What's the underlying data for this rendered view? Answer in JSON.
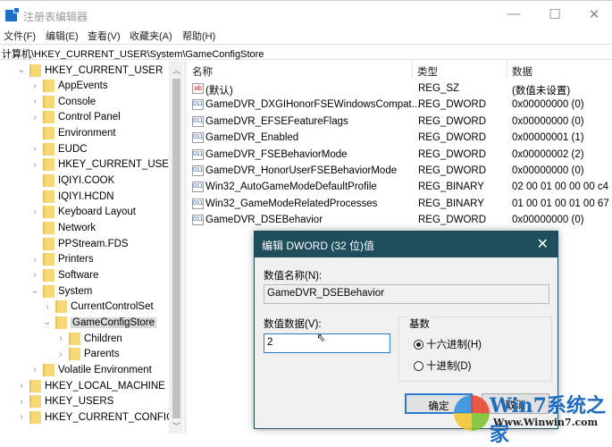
{
  "window": {
    "title": "注册表编辑器",
    "minimize": "—",
    "maximize": "☐",
    "close": "✕"
  },
  "menu": [
    "文件(F)",
    "编辑(E)",
    "查看(V)",
    "收藏夹(A)",
    "帮助(H)"
  ],
  "address": "计算机\\HKEY_CURRENT_USER\\System\\GameConfigStore",
  "tree": [
    {
      "label": "HKEY_CURRENT_USER",
      "level": 0,
      "exp": "⌄"
    },
    {
      "label": "AppEvents",
      "level": 1,
      "exp": "›"
    },
    {
      "label": "Console",
      "level": 1,
      "exp": "›"
    },
    {
      "label": "Control Panel",
      "level": 1,
      "exp": "›"
    },
    {
      "label": "Environment",
      "level": 1,
      "exp": ""
    },
    {
      "label": "EUDC",
      "level": 1,
      "exp": "›"
    },
    {
      "label": "HKEY_CURRENT_USER",
      "level": 1,
      "exp": "›"
    },
    {
      "label": "IQIYI.COOK",
      "level": 1,
      "exp": ""
    },
    {
      "label": "IQIYI.HCDN",
      "level": 1,
      "exp": ""
    },
    {
      "label": "Keyboard Layout",
      "level": 1,
      "exp": "›"
    },
    {
      "label": "Network",
      "level": 1,
      "exp": ""
    },
    {
      "label": "PPStream.FDS",
      "level": 1,
      "exp": ""
    },
    {
      "label": "Printers",
      "level": 1,
      "exp": "›"
    },
    {
      "label": "Software",
      "level": 1,
      "exp": "›"
    },
    {
      "label": "System",
      "level": 1,
      "exp": "⌄"
    },
    {
      "label": "CurrentControlSet",
      "level": 2,
      "exp": "›"
    },
    {
      "label": "GameConfigStore",
      "level": 2,
      "exp": "⌄",
      "selected": true
    },
    {
      "label": "Children",
      "level": 3,
      "exp": "›"
    },
    {
      "label": "Parents",
      "level": 3,
      "exp": "›"
    },
    {
      "label": "Volatile Environment",
      "level": 1,
      "exp": "›"
    },
    {
      "label": "HKEY_LOCAL_MACHINE",
      "level": 0,
      "exp": "›"
    },
    {
      "label": "HKEY_USERS",
      "level": 0,
      "exp": "›"
    },
    {
      "label": "HKEY_CURRENT_CONFIG",
      "level": 0,
      "exp": "›"
    }
  ],
  "columns": {
    "name": "名称",
    "type": "类型",
    "data": "数据"
  },
  "values": [
    {
      "icon": "ab",
      "name": "(默认)",
      "type": "REG_SZ",
      "data": "(数值未设置)"
    },
    {
      "icon": "bin",
      "name": "GameDVR_DXGIHonorFSEWindowsCompat...",
      "type": "REG_DWORD",
      "data": "0x00000000 (0)"
    },
    {
      "icon": "bin",
      "name": "GameDVR_EFSEFeatureFlags",
      "type": "REG_DWORD",
      "data": "0x00000000 (0)"
    },
    {
      "icon": "bin",
      "name": "GameDVR_Enabled",
      "type": "REG_DWORD",
      "data": "0x00000001 (1)"
    },
    {
      "icon": "bin",
      "name": "GameDVR_FSEBehaviorMode",
      "type": "REG_DWORD",
      "data": "0x00000002 (2)"
    },
    {
      "icon": "bin",
      "name": "GameDVR_HonorUserFSEBehaviorMode",
      "type": "REG_DWORD",
      "data": "0x00000000 (0)"
    },
    {
      "icon": "bin",
      "name": "Win32_AutoGameModeDefaultProfile",
      "type": "REG_BINARY",
      "data": "02 00 01 00 00 00 c4"
    },
    {
      "icon": "bin",
      "name": "Win32_GameModeRelatedProcesses",
      "type": "REG_BINARY",
      "data": "01 00 01 00 01 00 67"
    },
    {
      "icon": "bin",
      "name": "GameDVR_DSEBehavior",
      "type": "REG_DWORD",
      "data": "0x00000000 (0)"
    }
  ],
  "dialog": {
    "title": "编辑 DWORD (32 位)值",
    "name_label": "数值名称(N):",
    "name_value": "GameDVR_DSEBehavior",
    "data_label": "数值数据(V):",
    "data_value": "2",
    "base_label": "基数",
    "hex": "十六进制(H)",
    "dec": "十进制(D)",
    "ok": "确定",
    "cancel": "取消",
    "close": "✕"
  },
  "watermark": {
    "brand": "Win7系统之家",
    "url": "Www.Winwin7.com"
  }
}
